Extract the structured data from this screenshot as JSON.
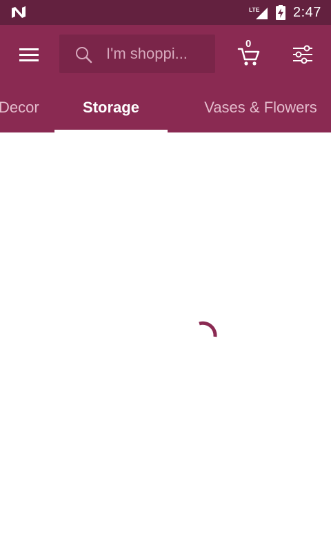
{
  "status_bar": {
    "time": "2:47",
    "network_label": "LTE",
    "notification_icon": "n-logo-icon",
    "signal_icon": "signal-icon",
    "battery_icon": "battery-charging-icon"
  },
  "app_bar": {
    "menu_icon": "menu-icon",
    "search": {
      "placeholder": "I'm shoppi...",
      "icon": "search-icon"
    },
    "cart": {
      "count": "0",
      "icon": "cart-icon"
    },
    "filter_icon": "filter-icon"
  },
  "tabs": [
    {
      "label": "Decor",
      "active": false
    },
    {
      "label": "Storage",
      "active": true
    },
    {
      "label": "Vases & Flowers",
      "active": false
    }
  ],
  "colors": {
    "status_bar": "#63213f",
    "app_bar": "#8a2a52",
    "search_box": "#7a2549",
    "spinner": "#8a2a52",
    "content_background": "#ffffff"
  },
  "loading": {
    "icon": "loading-spinner"
  }
}
